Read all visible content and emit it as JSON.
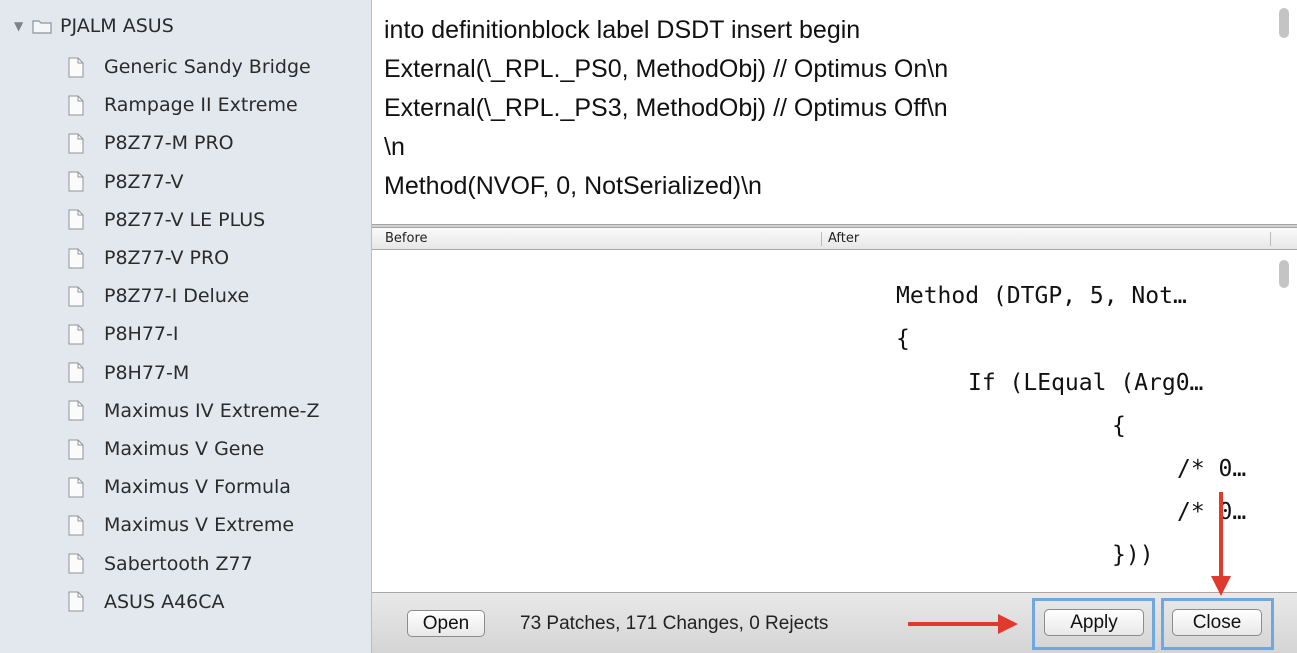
{
  "sidebar": {
    "group": {
      "label": "PJALM ASUS",
      "icon": "folder-icon",
      "disclosure": "▼"
    },
    "items": [
      {
        "label": "Generic Sandy Bridge",
        "icon": "document-icon"
      },
      {
        "label": "Rampage II Extreme",
        "icon": "document-icon"
      },
      {
        "label": "P8Z77-M PRO",
        "icon": "document-icon"
      },
      {
        "label": "P8Z77-V",
        "icon": "document-icon"
      },
      {
        "label": "P8Z77-V LE PLUS",
        "icon": "document-icon"
      },
      {
        "label": "P8Z77-V PRO",
        "icon": "document-icon"
      },
      {
        "label": "P8Z77-I Deluxe",
        "icon": "document-icon"
      },
      {
        "label": "P8H77-I",
        "icon": "document-icon"
      },
      {
        "label": "P8H77-M",
        "icon": "document-icon"
      },
      {
        "label": "Maximus IV Extreme-Z",
        "icon": "document-icon"
      },
      {
        "label": "Maximus V Gene",
        "icon": "document-icon"
      },
      {
        "label": "Maximus V Formula",
        "icon": "document-icon"
      },
      {
        "label": "Maximus V Extreme",
        "icon": "document-icon"
      },
      {
        "label": "Sabertooth Z77",
        "icon": "document-icon"
      },
      {
        "label": "ASUS A46CA",
        "icon": "document-icon"
      }
    ]
  },
  "patch_text": {
    "lines": [
      "into definitionblock label DSDT insert begin",
      "External(\\_RPL._PS0, MethodObj) // Optimus On\\n",
      "External(\\_RPL._PS3, MethodObj) // Optimus Off\\n",
      "\\n",
      "Method(NVOF, 0, NotSerialized)\\n"
    ]
  },
  "compare": {
    "before_label": "Before",
    "after_label": "After",
    "after_lines": [
      "Method (DTGP, 5, Not…",
      "{",
      "If (LEqual (Arg0…",
      "{",
      "/* 0…",
      "/* 0…",
      "}))"
    ]
  },
  "bottom_bar": {
    "open_label": "Open",
    "status": "73 Patches, 171 Changes, 0 Rejects",
    "apply_label": "Apply",
    "close_label": "Close"
  },
  "colors": {
    "annotation_arrow": "#e03a2f",
    "highlight_box": "#6fa8e0",
    "sidebar_bg": "#e3e8ee"
  }
}
